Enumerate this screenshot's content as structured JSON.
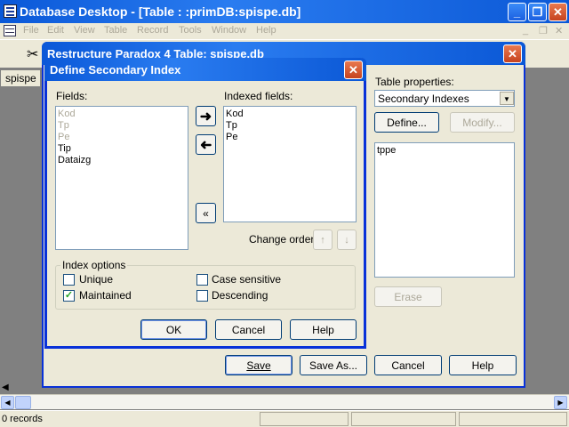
{
  "app": {
    "title": "Database Desktop - [Table : :primDB:spispe.db]",
    "menu": [
      "File",
      "Edit",
      "View",
      "Table",
      "Record",
      "Tools",
      "Window",
      "Help"
    ],
    "doc_tab": "spispe",
    "status": {
      "records": "0 records"
    }
  },
  "restructure": {
    "title": "Restructure Paradox 4 Table: spispe.db",
    "table_properties_label": "Table properties:",
    "table_properties_value": "Secondary Indexes",
    "define_label": "Define...",
    "modify_label": "Modify...",
    "index_list": [
      "tppe"
    ],
    "erase_label": "Erase",
    "save_label": "Save",
    "save_as_label": "Save As...",
    "cancel_label": "Cancel",
    "help_label": "Help"
  },
  "dialog": {
    "title": "Define Secondary Index",
    "fields_label": "Fields:",
    "fields": [
      {
        "name": "Kod",
        "disabled": true
      },
      {
        "name": "Tp",
        "disabled": true
      },
      {
        "name": "Pe",
        "disabled": true
      },
      {
        "name": "Tip",
        "disabled": false
      },
      {
        "name": "Dataizg",
        "disabled": false
      }
    ],
    "indexed_fields_label": "Indexed fields:",
    "indexed_fields": [
      "Kod",
      "Tp",
      "Pe"
    ],
    "change_order_label": "Change order:",
    "index_options_label": "Index options",
    "options": {
      "unique": {
        "label": "Unique",
        "checked": false
      },
      "maintained": {
        "label": "Maintained",
        "checked": true
      },
      "case_sensitive": {
        "label": "Case sensitive",
        "checked": false
      },
      "descending": {
        "label": "Descending",
        "checked": false
      }
    },
    "ok_label": "OK",
    "cancel_label": "Cancel",
    "help_label": "Help"
  }
}
